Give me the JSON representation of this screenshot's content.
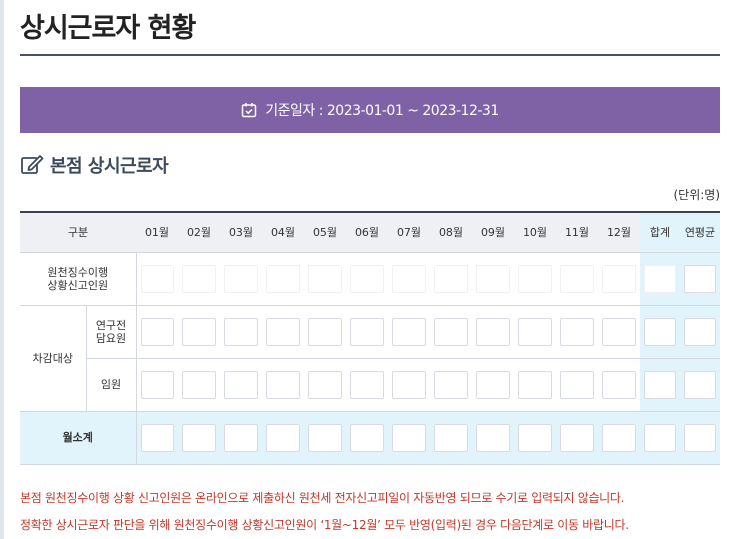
{
  "page": {
    "title": "상시근로자 현황"
  },
  "date_bar": {
    "label": "기준일자 : 2023-01-01 ~ 2023-12-31",
    "icon": "calendar-check-icon",
    "color": "#7f62a6"
  },
  "section": {
    "title": "본점 상시근로자",
    "icon": "edit-icon"
  },
  "unit": "(단위:명)",
  "table": {
    "header": {
      "category": "구분",
      "months": [
        "01월",
        "02월",
        "03월",
        "04월",
        "05월",
        "06월",
        "07월",
        "08월",
        "09월",
        "10월",
        "11월",
        "12월"
      ],
      "total": "합계",
      "annual_avg": "연평균"
    },
    "rows": {
      "withholding": "원천징수이행\n상황신고인원",
      "deduction_group": "차감대상",
      "research": "연구전\n담요원",
      "executive": "임원",
      "subtotal": "월소계"
    },
    "highlight_color": "#e1f3fb"
  },
  "notes": [
    "본점 원천징수이행 상황 신고인원은 온라인으로 제출하신 원천세 전자신고피일이 자동반영 되므로 수기로 입력되지 않습니다.",
    "정확한 상시근로자 판단을 위해 원천징수이행 상황신고인원이 ‘1월~12월’ 모두 반영(입력)된 경우 다음단계로 이동 바랍니다."
  ]
}
